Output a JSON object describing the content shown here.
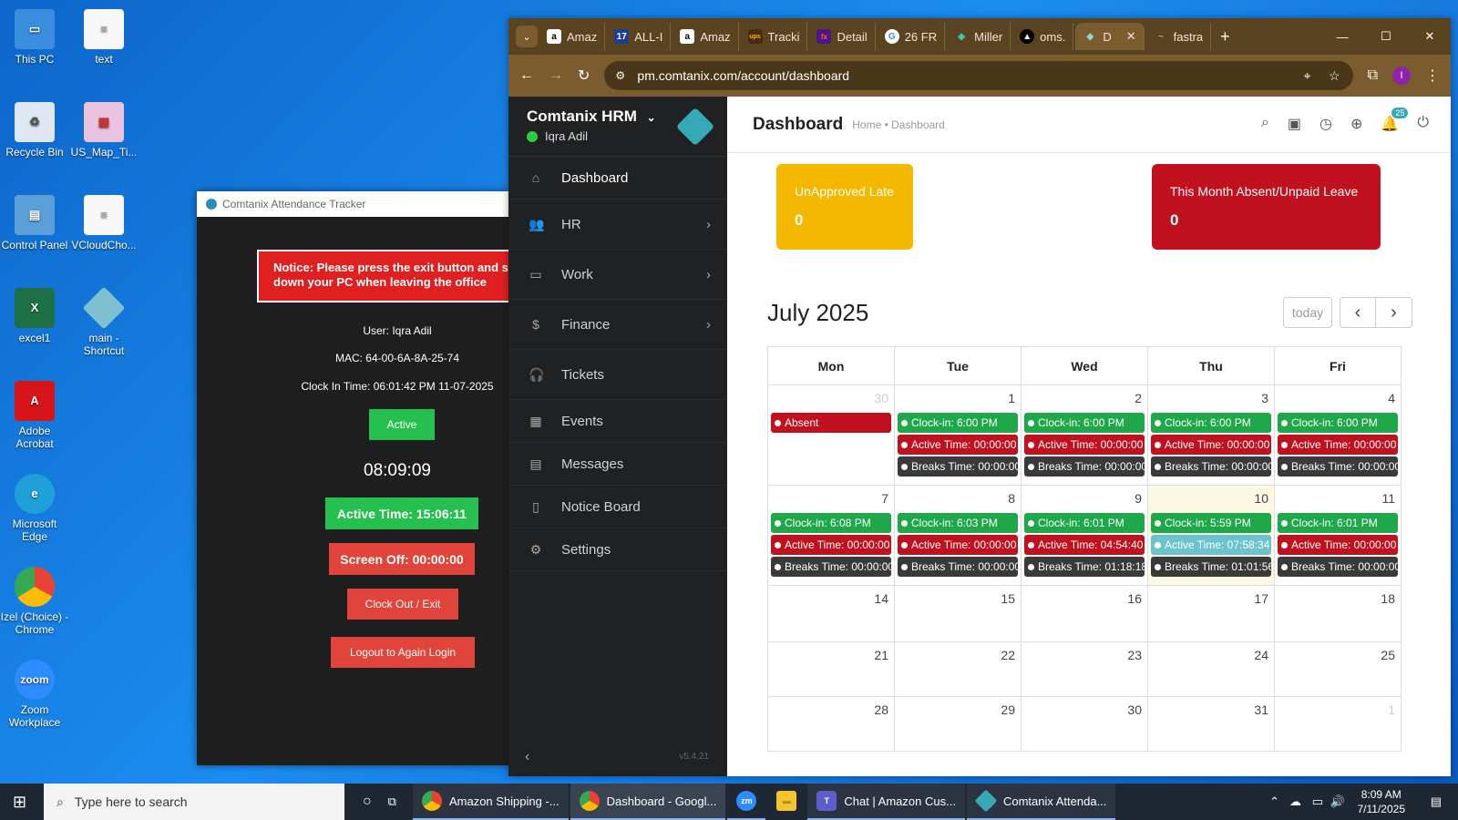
{
  "desktop": {
    "icons": [
      {
        "label": "This PC"
      },
      {
        "label": "text"
      },
      {
        "label": "Recycle Bin"
      },
      {
        "label": "US_Map_Ti..."
      },
      {
        "label": "Control Panel"
      },
      {
        "label": "VCloudCho..."
      },
      {
        "label": "excel1"
      },
      {
        "label": "main - Shortcut"
      },
      {
        "label": "Adobe Acrobat"
      },
      {
        "label": "Microsoft Edge"
      },
      {
        "label": "Izel (Choice) - Chrome"
      },
      {
        "label": "Zoom Workplace"
      }
    ]
  },
  "tracker": {
    "title": "Comtanix Attendance Tracker",
    "notice": "Notice: Please press the exit button and s down your PC when leaving the office",
    "user": "User: Iqra Adil",
    "mac": "MAC: 64-00-6A-8A-25-74",
    "clock_in": "Clock In Time: 06:01:42 PM 11-07-2025",
    "status": "Active",
    "timer": "08:09:09",
    "active_time": "Active Time: 15:06:11",
    "screen_off": "Screen Off: 00:00:00",
    "clock_out": "Clock Out / Exit",
    "logout": "Logout to Again Login"
  },
  "browser": {
    "tabs": [
      {
        "label": "Amaz",
        "icon": "a"
      },
      {
        "label": "ALL-I",
        "icon": "17"
      },
      {
        "label": "Amaz",
        "icon": "a"
      },
      {
        "label": "Tracki",
        "icon": "ups"
      },
      {
        "label": "Detail",
        "icon": "fx"
      },
      {
        "label": "26 FR",
        "icon": "G"
      },
      {
        "label": "Miller",
        "icon": "◆"
      },
      {
        "label": "oms.",
        "icon": "▲"
      },
      {
        "label": "D",
        "icon": "◆"
      },
      {
        "label": "fastra",
        "icon": "~"
      }
    ],
    "url": "pm.comtanix.com/account/dashboard",
    "profile_initial": "I"
  },
  "app": {
    "brand": "Comtanix HRM",
    "user": "Iqra Adil",
    "nav": [
      {
        "label": "Dashboard",
        "icon": "⌂",
        "chevron": false
      },
      {
        "label": "HR",
        "icon": "👥",
        "chevron": true
      },
      {
        "label": "Work",
        "icon": "▭",
        "chevron": true
      },
      {
        "label": "Finance",
        "icon": "$",
        "chevron": true
      },
      {
        "label": "Tickets",
        "icon": "🎧",
        "chevron": false
      },
      {
        "label": "Events",
        "icon": "▦",
        "chevron": false
      },
      {
        "label": "Messages",
        "icon": "▤",
        "chevron": false
      },
      {
        "label": "Notice Board",
        "icon": "▯",
        "chevron": false
      },
      {
        "label": "Settings",
        "icon": "⚙",
        "chevron": false
      }
    ],
    "version": "v5.4.21",
    "page_title": "Dashboard",
    "breadcrumb": "Home • Dashboard",
    "notification_count": "25",
    "cards": {
      "late": {
        "label": "UnApproved Late",
        "value": "0",
        "color": "#f5b800"
      },
      "absent": {
        "label": "This Month Absent/Unpaid Leave",
        "value": "0",
        "color": "#c2111e"
      }
    },
    "calendar": {
      "title": "July 2025",
      "today_label": "today",
      "prev": "‹",
      "next": "›",
      "headers": [
        "Mon",
        "Tue",
        "Wed",
        "Thu",
        "Fri"
      ],
      "weeks": [
        [
          {
            "day": "30",
            "other": true,
            "events": [
              {
                "text": "Absent",
                "type": "red"
              }
            ]
          },
          {
            "day": "1",
            "events": [
              {
                "text": "Clock-in: 6:00 PM",
                "type": "green"
              },
              {
                "text": "Active Time: 00:00:00",
                "type": "red"
              },
              {
                "text": "Breaks Time: 00:00:00",
                "type": "dark"
              }
            ]
          },
          {
            "day": "2",
            "events": [
              {
                "text": "Clock-in: 6:00 PM",
                "type": "green"
              },
              {
                "text": "Active Time: 00:00:00",
                "type": "red"
              },
              {
                "text": "Breaks Time: 00:00:00",
                "type": "dark"
              }
            ]
          },
          {
            "day": "3",
            "events": [
              {
                "text": "Clock-in: 6:00 PM",
                "type": "green"
              },
              {
                "text": "Active Time: 00:00:00",
                "type": "red"
              },
              {
                "text": "Breaks Time: 00:00:00",
                "type": "dark"
              }
            ]
          },
          {
            "day": "4",
            "events": [
              {
                "text": "Clock-in: 6:00 PM",
                "type": "green"
              },
              {
                "text": "Active Time: 00:00:00",
                "type": "red"
              },
              {
                "text": "Breaks Time: 00:00:00",
                "type": "dark"
              }
            ]
          }
        ],
        [
          {
            "day": "7",
            "events": [
              {
                "text": "Clock-in: 6:08 PM",
                "type": "green"
              },
              {
                "text": "Active Time: 00:00:00",
                "type": "red"
              },
              {
                "text": "Breaks Time: 00:00:00",
                "type": "dark"
              }
            ]
          },
          {
            "day": "8",
            "events": [
              {
                "text": "Clock-in: 6:03 PM",
                "type": "green"
              },
              {
                "text": "Active Time: 00:00:00",
                "type": "red"
              },
              {
                "text": "Breaks Time: 00:00:00",
                "type": "dark"
              }
            ]
          },
          {
            "day": "9",
            "events": [
              {
                "text": "Clock-in: 6:01 PM",
                "type": "green"
              },
              {
                "text": "Active Time: 04:54:40",
                "type": "red"
              },
              {
                "text": "Breaks Time: 01:18:18",
                "type": "dark"
              }
            ]
          },
          {
            "day": "10",
            "today": true,
            "events": [
              {
                "text": "Clock-in: 5:59 PM",
                "type": "green"
              },
              {
                "text": "Active Time: 07:58:34",
                "type": "teal"
              },
              {
                "text": "Breaks Time: 01:01:56",
                "type": "dark"
              }
            ]
          },
          {
            "day": "11",
            "events": [
              {
                "text": "Clock-in: 6:01 PM",
                "type": "green"
              },
              {
                "text": "Active Time: 00:00:00",
                "type": "red"
              },
              {
                "text": "Breaks Time: 00:00:00",
                "type": "dark"
              }
            ]
          }
        ],
        [
          {
            "day": "14",
            "events": []
          },
          {
            "day": "15",
            "events": []
          },
          {
            "day": "16",
            "events": []
          },
          {
            "day": "17",
            "events": []
          },
          {
            "day": "18",
            "events": []
          }
        ],
        [
          {
            "day": "21",
            "events": []
          },
          {
            "day": "22",
            "events": []
          },
          {
            "day": "23",
            "events": []
          },
          {
            "day": "24",
            "events": []
          },
          {
            "day": "25",
            "events": []
          }
        ],
        [
          {
            "day": "28",
            "events": []
          },
          {
            "day": "29",
            "events": []
          },
          {
            "day": "30",
            "events": []
          },
          {
            "day": "31",
            "events": []
          },
          {
            "day": "1",
            "other": true,
            "events": []
          }
        ]
      ]
    }
  },
  "taskbar": {
    "search_placeholder": "Type here to search",
    "items": [
      {
        "label": "Amazon Shipping -...",
        "icon_color": "#e94235"
      },
      {
        "label": "Dashboard - Googl...",
        "icon_color": "#e94235"
      },
      {
        "label": "",
        "icon_color": "#2d8cff",
        "icon_text": "zm"
      },
      {
        "label": "",
        "icon_color": "#f4c430",
        "icon_text": "▬"
      },
      {
        "label": "Chat | Amazon Cus...",
        "icon_color": "#5b5fc7"
      },
      {
        "label": "Comtanix Attenda...",
        "icon_color": "#35a9b5"
      }
    ],
    "time": "8:09 AM",
    "date": "7/11/2025"
  }
}
